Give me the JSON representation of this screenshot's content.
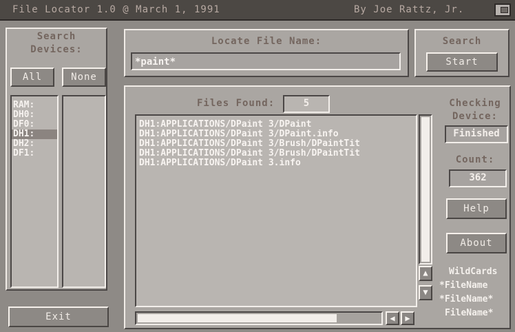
{
  "window": {
    "title": "File Locator 1.0 @ March 1, 1991",
    "author": "By Joe Rattz, Jr."
  },
  "search_devices": {
    "label_line1": "Search",
    "label_line2": "Devices:",
    "all_label": "All",
    "none_label": "None",
    "devices": [
      "RAM:",
      "DH0:",
      "DF0:",
      "DH1:",
      "DH2:",
      "DF1:"
    ],
    "selected_index": 3
  },
  "locate": {
    "label": "Locate File Name:",
    "value": "*paint*"
  },
  "search": {
    "label": "Search",
    "start_label": "Start"
  },
  "results": {
    "files_found_label": "Files Found:",
    "files_found_count": "5",
    "files": [
      "DH1:APPLICATIONS/DPaint 3/DPaint",
      "DH1:APPLICATIONS/DPaint 3/DPaint.info",
      "DH1:APPLICATIONS/DPaint 3/Brush/DPaintTit",
      "DH1:APPLICATIONS/DPaint 3/Brush/DPaintTit",
      "DH1:APPLICATIONS/DPaint 3.info"
    ],
    "horizontal_scroll_fraction": 0.82
  },
  "status": {
    "checking_line1": "Checking",
    "checking_line2": "Device:",
    "checking_value": "Finished",
    "count_label": "Count:",
    "count_value": "362",
    "help_label": "Help",
    "about_label": "About"
  },
  "wildcards": {
    "title": "WildCards",
    "examples": [
      "*FileName",
      "*FileName*",
      "FileName*"
    ]
  },
  "exit_label": "Exit",
  "icons": {
    "depth": "depth-gadget-icon",
    "up": "arrow-up-icon",
    "down": "arrow-down-icon",
    "left": "arrow-left-icon",
    "right": "arrow-right-icon"
  },
  "colors": {
    "background": "#8e8a86",
    "panel": "#aaa6a2",
    "text": "#f6f2ef"
  }
}
